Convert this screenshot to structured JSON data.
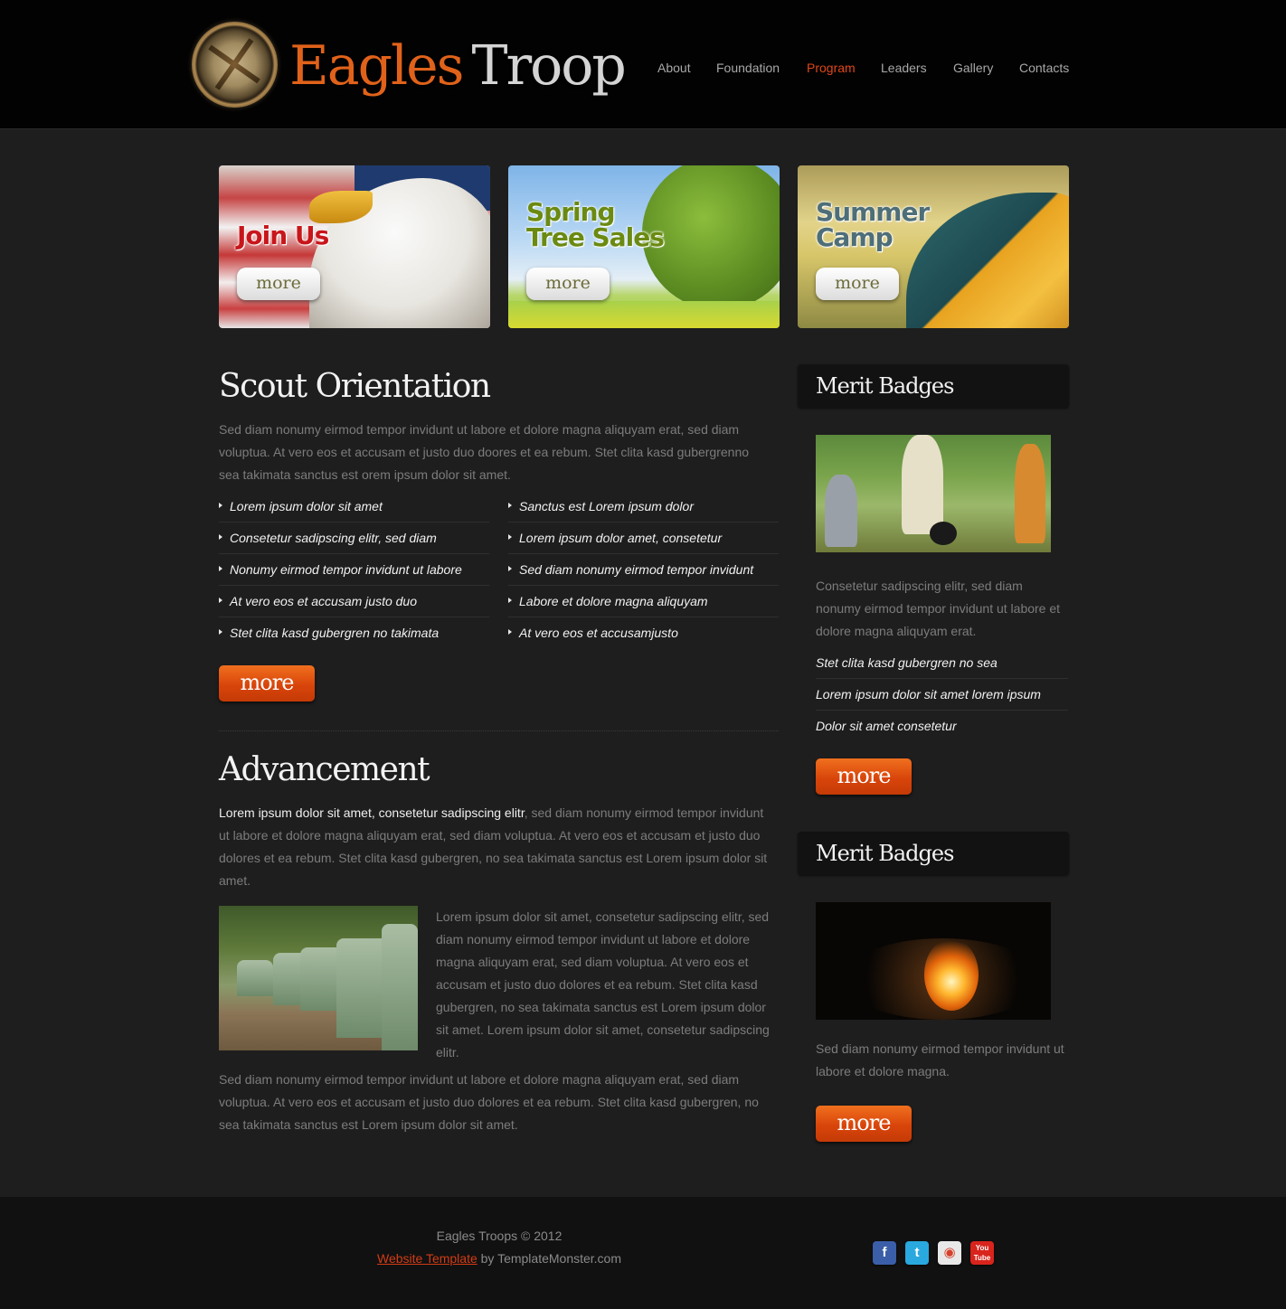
{
  "header": {
    "logo_word1": "Eagles",
    "logo_word2": "Troop",
    "nav": [
      {
        "label": "About"
      },
      {
        "label": "Foundation"
      },
      {
        "label": "Program"
      },
      {
        "label": "Leaders"
      },
      {
        "label": "Gallery"
      },
      {
        "label": "Contacts"
      }
    ],
    "active_nav": "Program"
  },
  "banners": [
    {
      "title_line1": "Join Us",
      "title_line2": "",
      "button": "more",
      "title_color": "#c8161b"
    },
    {
      "title_line1": "Spring",
      "title_line2": "Tree Sales",
      "button": "more",
      "title_color": "#6b8a12"
    },
    {
      "title_line1": "Summer",
      "title_line2": "Camp",
      "button": "more",
      "title_color": "#4e6e78"
    }
  ],
  "scout_orientation": {
    "title": "Scout Orientation",
    "text": "Sed diam nonumy eirmod tempor invidunt ut labore et dolore magna aliquyam erat, sed diam voluptua. At vero eos et accusam et justo duo doores et ea rebum. Stet clita kasd gubergrenno sea takimata sanctus est orem ipsum dolor sit amet.",
    "list_left": [
      "Lorem ipsum dolor sit amet",
      "Consetetur sadipscing elitr, sed diam",
      "Nonumy eirmod tempor invidunt ut labore",
      "At vero eos et accusam justo duo",
      "Stet clita kasd gubergren no takimata"
    ],
    "list_right": [
      "Sanctus est Lorem ipsum dolor",
      "Lorem ipsum dolor amet, consetetur",
      "Sed diam nonumy eirmod tempor invidunt",
      "Labore et dolore magna aliquyam",
      "At vero eos et accusamjusto"
    ],
    "button": "more"
  },
  "advancement": {
    "title": "Advancement",
    "intro_strong": "Lorem ipsum dolor sit amet, consetetur sadipscing elitr",
    "intro_rest": ", sed diam nonumy eirmod tempor invidunt ut labore et dolore magna aliquyam erat, sed diam voluptua. At vero eos et accusam et justo duo dolores et ea rebum. Stet clita kasd gubergren, no sea takimata sanctus est Lorem ipsum dolor sit amet.",
    "side_text": "Lorem ipsum dolor sit amet, consetetur sadipscing elitr, sed diam nonumy eirmod tempor invidunt ut labore et dolore magna aliquyam erat, sed diam voluptua. At vero eos et accusam et justo duo dolores et ea rebum. Stet clita kasd gubergren, no sea takimata sanctus est Lorem ipsum dolor sit amet. Lorem ipsum dolor sit amet, consetetur sadipscing elitr.",
    "closing": "Sed diam nonumy eirmod tempor invidunt ut labore et dolore magna aliquyam erat, sed diam voluptua. At vero eos et accusam et justo duo dolores et ea rebum. Stet clita kasd gubergren, no sea takimata sanctus est Lorem ipsum dolor sit amet."
  },
  "sidebar": {
    "box1": {
      "title": "Merit Badges",
      "text": "Consetetur sadipscing elitr, sed diam nonumy eirmod tempor invidunt ut labore et dolore magna aliquyam erat.",
      "list": [
        "Stet clita kasd gubergren no sea",
        "Lorem ipsum dolor sit amet lorem ipsum",
        "Dolor sit amet consetetur"
      ],
      "button": "more"
    },
    "box2": {
      "title": "Merit Badges",
      "text": "Sed diam nonumy eirmod tempor invidunt ut labore et dolore magna.",
      "button": "more"
    }
  },
  "footer": {
    "copyright": "Eagles Troops © 2012",
    "link_text": "Website Template",
    "credit_rest": " by TemplateMonster.com",
    "social": [
      {
        "icon": "facebook-icon",
        "glyph": "f",
        "color": "#3b5ea8"
      },
      {
        "icon": "twitter-icon",
        "glyph": "t",
        "color": "#29a9df"
      },
      {
        "icon": "picasa-icon",
        "glyph": "◉",
        "color": "#e8e8e8"
      },
      {
        "icon": "youtube-icon",
        "glyph": "You Tube",
        "color": "#d8241c"
      }
    ]
  },
  "colors": {
    "accent": "#e0461a",
    "background": "#1e1e1e",
    "header": "#020202"
  }
}
